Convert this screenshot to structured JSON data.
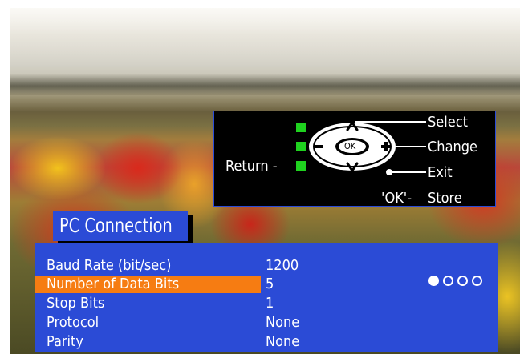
{
  "help_panel": {
    "select_label": "Select",
    "change_label": "Change",
    "exit_label": "Exit",
    "return_label": "Return -",
    "ok_key_label": "'OK'-",
    "store_label": "Store",
    "ok_button_label": "OK"
  },
  "menu": {
    "title": "PC Connection",
    "rows": [
      {
        "label": "Baud Rate (bit/sec)",
        "value": "1200",
        "selected": false
      },
      {
        "label": "Number of Data Bits",
        "value": "5",
        "selected": true
      },
      {
        "label": "Stop Bits",
        "value": "1",
        "selected": false
      },
      {
        "label": "Protocol",
        "value": "None",
        "selected": false
      },
      {
        "label": "Parity",
        "value": "None",
        "selected": false
      }
    ],
    "pages": {
      "total": 4,
      "current": 1
    }
  },
  "colors": {
    "panel_blue": "#2b4bd6",
    "highlight_orange": "#f67c12",
    "indicator_green": "#1fd21f"
  }
}
